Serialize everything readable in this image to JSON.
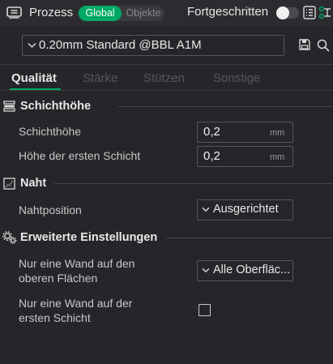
{
  "header": {
    "title": "Prozess",
    "segment_global": "Global",
    "segment_objects": "Objekte",
    "advanced_label": "Fortgeschritten",
    "advanced_enabled": false,
    "accent_color": "#00a865"
  },
  "preset": {
    "value": "0.20mm Standard @BBL A1M",
    "icons": [
      "chevron-down-icon",
      "save-icon",
      "search-icon"
    ]
  },
  "tabs": [
    {
      "label": "Qualität",
      "active": true
    },
    {
      "label": "Stärke",
      "active": false
    },
    {
      "label": "Stützen",
      "active": false
    },
    {
      "label": "Sonstige",
      "active": false
    }
  ],
  "sections": {
    "layer_height": {
      "title": "Schichthöhe",
      "icon": "layers-icon",
      "rows": [
        {
          "label": "Schichthöhe",
          "value": "0,2",
          "unit": "mm"
        },
        {
          "label": "Höhe der ersten Schicht",
          "value": "0,2",
          "unit": "mm"
        }
      ]
    },
    "seam": {
      "title": "Naht",
      "icon": "seam-icon",
      "rows": [
        {
          "label": "Nahtposition",
          "value": "Ausgerichtet"
        }
      ]
    },
    "advanced": {
      "title": "Erweiterte Einstellungen",
      "icon": "gears-icon",
      "rows": [
        {
          "label_line1": "Nur eine Wand auf den",
          "label_line2": "oberen Flächen",
          "value": "Alle Oberfläc..."
        },
        {
          "label_line1": "Nur eine Wand auf der",
          "label_line2": "ersten Schicht",
          "checked": false
        }
      ]
    }
  }
}
